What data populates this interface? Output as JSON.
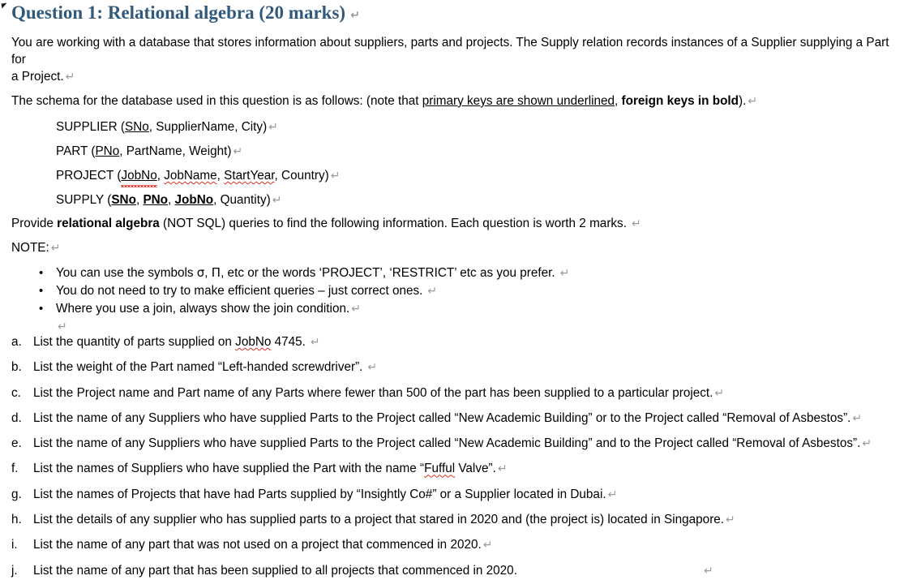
{
  "document": {
    "heading": "Question 1: Relational algebra (20 marks)",
    "intro": {
      "line1_a": "You are working with a database that stores information about suppliers, parts and projects. The Supply relation records instances of a Supplier supplying a Part for",
      "line1_b": "a Project."
    },
    "schema_intro": {
      "before": "The schema for the database used in this question is as follows: (note that ",
      "underlined": "primary keys are shown underlined",
      "middle": ", ",
      "bold": "foreign keys in bold",
      "after": ")."
    },
    "schema": [
      {
        "relation": "SUPPLIER",
        "open": " (",
        "key": "SNo",
        "rest": ", SupplierName, City)"
      },
      {
        "relation": "PART",
        "open": " (",
        "key": "PNo",
        "rest": ", PartName, Weight)"
      },
      {
        "relation": "PROJECT",
        "open": " (",
        "key": "JobNo",
        "rest_a": ", ",
        "misspelled_1": "JobName",
        "rest_b": ", ",
        "misspelled_2": "StartYear",
        "rest_c": ", Country)"
      },
      {
        "relation": "SUPPLY",
        "open": " (",
        "key1": "SNo",
        "sep1": ", ",
        "key2": "PNo",
        "sep2": ", ",
        "key3": "JobNo",
        "rest": ", Quantity)"
      }
    ],
    "provide": {
      "before": "Provide ",
      "bold": "relational algebra",
      "after": " (NOT SQL) queries to find the following information. Each question is worth 2 marks."
    },
    "note_label": "NOTE:",
    "notes": [
      {
        "before": "You can use the symbols  ",
        "symbol_sigma": "σ",
        "between": ", ",
        "symbol_pi": "Π",
        "after": ", etc or the words ‘PROJECT’, ‘RESTRICT’ etc as you prefer."
      },
      {
        "text": "You do not need to try to make efficient queries – just correct ones."
      },
      {
        "text": "Where you use a join, always show the join condition."
      }
    ],
    "questions": [
      {
        "marker": "a.",
        "before": "List the quantity of parts supplied on ",
        "misspelled": "JobNo",
        "after": " 4745."
      },
      {
        "marker": "b.",
        "text": "List the weight of the Part named “Left-handed screwdriver”."
      },
      {
        "marker": "c.",
        "text": "List the Project name and Part name of any Parts where fewer than 500 of the part has been supplied to a particular project."
      },
      {
        "marker": "d.",
        "text": "List the name of any Suppliers who have supplied Parts to the Project called “New Academic Building” or to the Project called “Removal of Asbestos”."
      },
      {
        "marker": "e.",
        "text": "List the name of any Suppliers who have supplied Parts to the Project called “New Academic Building” and to the Project called “Removal of Asbestos”."
      },
      {
        "marker": "f.",
        "before": "List the names of Suppliers who have supplied the Part with the name “",
        "misspelled": "Fufful",
        "after": " Valve”."
      },
      {
        "marker": "g.",
        "text": "List the names of Projects that have had Parts supplied by “Insightly Co#” or a Supplier located in Dubai."
      },
      {
        "marker": "h.",
        "text": "List the details of any supplier who has supplied parts to a project that stared in 2020 and (the project is) located in Singapore."
      },
      {
        "marker": "i.",
        "text": "List the name of any part that was not used on a project that commenced in 2020."
      },
      {
        "marker": "j.",
        "text": "List the name of any part that has been supplied to all projects that commenced in 2020."
      }
    ],
    "marks": {
      "return_symbol": "↵",
      "bullet_symbol": "•"
    },
    "colors": {
      "heading": "#31597C",
      "formatting_mark": "#9a9a9a",
      "spellcheck": "#D93025",
      "body_text": "#000000",
      "background": "#ffffff"
    }
  }
}
